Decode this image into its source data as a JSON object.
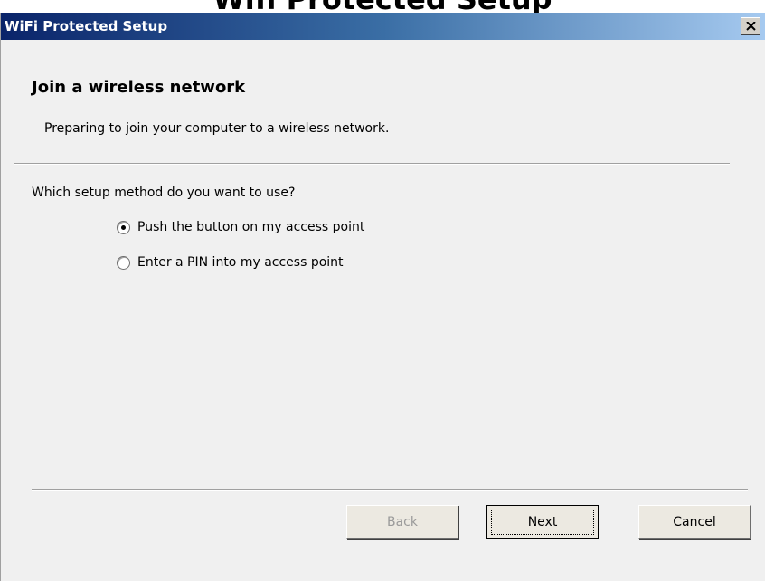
{
  "top_strip_text": "Wifi Protected Setup",
  "window": {
    "title": "WiFi Protected Setup",
    "close_glyph": "×"
  },
  "content": {
    "heading": "Join a wireless network",
    "subtitle": "Preparing to join your computer to a wireless network.",
    "question": "Which setup method do you want to use?",
    "options": [
      {
        "label": "Push the button on my access point",
        "selected": true
      },
      {
        "label": "Enter a PIN into my access point",
        "selected": false
      }
    ]
  },
  "buttons": {
    "back": "Back",
    "next": "Next",
    "cancel": "Cancel"
  }
}
